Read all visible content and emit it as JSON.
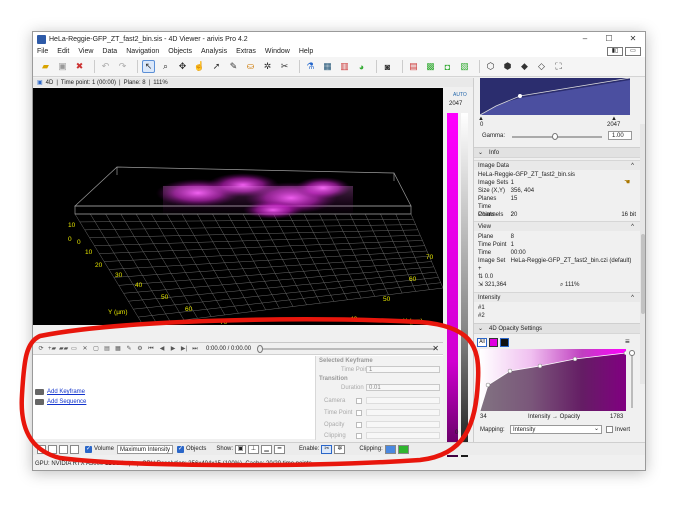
{
  "window": {
    "title": "HeLa-Reggie-GFP_ZT_fast2_bin.sis - 4D Viewer - arivis Pro 4.2",
    "controls": [
      "–",
      "☐",
      "✕"
    ]
  },
  "menu": [
    "File",
    "Edit",
    "View",
    "Data",
    "Navigation",
    "Objects",
    "Analysis",
    "Extras",
    "Window",
    "Help"
  ],
  "info_strip": {
    "mode": "4D",
    "timepoint": "Time point: 1 (00:00)",
    "plane": "Plane: 8",
    "zoom": "111%"
  },
  "viewport": {
    "y_axis_label": "Y (µm)",
    "x_axis_label": "X (µm)",
    "y_ticks": [
      "0",
      "10",
      "20",
      "30",
      "40",
      "50",
      "60",
      "70",
      "80"
    ],
    "x_ticks": [
      "0",
      "10",
      "20",
      "30",
      "40",
      "50",
      "60",
      "70"
    ],
    "x_side_ticks": [
      "70",
      "60",
      "50",
      "40",
      "30",
      "20"
    ],
    "z_ticks": [
      "10",
      "0"
    ]
  },
  "lut": {
    "auto": "AUTO",
    "max": "2047",
    "min": "0"
  },
  "histogram": {
    "min": "0",
    "max": "2047",
    "gamma_label": "Gamma:",
    "gamma_value": "1.00"
  },
  "info_panel": {
    "title": "Info",
    "image_data_title": "Image Data",
    "filename": "HeLa-Reggie-GFP_ZT_fast2_bin.sis",
    "rows": [
      {
        "k": "Image Sets",
        "v": "1"
      },
      {
        "k": "Size (X,Y)",
        "v": "356, 404"
      },
      {
        "k": "Planes",
        "v": "15"
      },
      {
        "k": "Time Points",
        "v": "20"
      },
      {
        "k": "Channels",
        "v": "2",
        "extra": "16 bit"
      }
    ],
    "view_title": "View",
    "view_rows": [
      {
        "k": "Plane",
        "v": "8"
      },
      {
        "k": "Time Point",
        "v": "1"
      },
      {
        "k": "Time",
        "v": "00:00"
      },
      {
        "k": "Image Set",
        "v": "HeLa-Reggie-GFP_ZT_fast2_bin.czi (default)"
      }
    ],
    "cursor_value": "0.0",
    "cursor_pos": "321,364",
    "cursor_zoom": "111%",
    "intensity_title": "Intensity",
    "intensity_rows": [
      "#1",
      "#2"
    ]
  },
  "opacity_panel": {
    "title": "4D Opacity Settings",
    "all_label": "All",
    "min": "34",
    "max": "1783",
    "axis_label": "Intensity → Opacity",
    "mapping_label": "Mapping:",
    "mapping_value": "Intensity",
    "invert_label": "Invert"
  },
  "animation": {
    "time_display": "0:00.00 / 0:00.00",
    "add_keyframe": "Add Keyframe",
    "add_sequence": "Add Sequence",
    "selected_keyframe": "Selected Keyframe",
    "time_point_label": "Time Point",
    "time_point_value": "1",
    "transition": "Transition",
    "duration_label": "Duration",
    "duration_value": "0.01",
    "camera": "Camera",
    "time_point2": "Time Point",
    "opacity": "Opacity",
    "clipping": "Clipping"
  },
  "bottom": {
    "volume": "Volume",
    "volume_mode": "Maximum Intensity",
    "objects": "Objects",
    "show": "Show:",
    "enable": "Enable:",
    "clipping": "Clipping:"
  },
  "status": "GPU: NVIDIA RTX A5000 12GB Laptop GPU Resolution: 356x404x15 (100%), Cache: 20/20 time points",
  "colors": {
    "accent": "#2a66c8",
    "magenta": "#ff00ff",
    "annotation": "#e8160c"
  }
}
